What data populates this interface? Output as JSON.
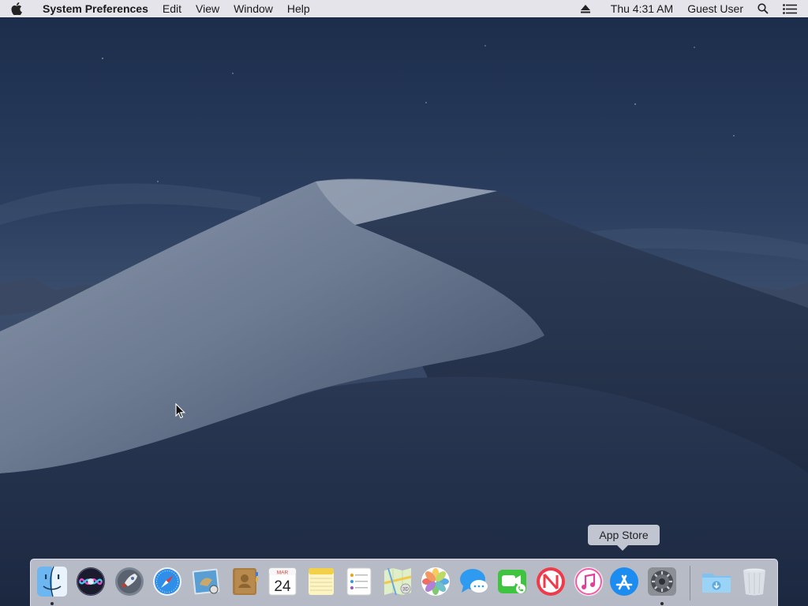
{
  "menubar": {
    "apple_icon": "apple-logo-icon",
    "app_name": "System Preferences",
    "menus": [
      "Edit",
      "View",
      "Window",
      "Help"
    ],
    "eject_icon": "eject-icon",
    "clock": "Thu 4:31 AM",
    "user": "Guest User",
    "search_icon": "spotlight-search-icon",
    "notification_icon": "notification-center-icon"
  },
  "tooltip": {
    "label": "App Store"
  },
  "dock": {
    "apps": [
      {
        "name": "Finder",
        "icon": "finder-icon",
        "running": true
      },
      {
        "name": "Siri",
        "icon": "siri-icon",
        "running": false
      },
      {
        "name": "Launchpad",
        "icon": "launchpad-icon",
        "running": false
      },
      {
        "name": "Safari",
        "icon": "safari-icon",
        "running": false
      },
      {
        "name": "Mail",
        "icon": "mail-icon",
        "running": false
      },
      {
        "name": "Contacts",
        "icon": "contacts-icon",
        "running": false
      },
      {
        "name": "Calendar",
        "icon": "calendar-icon",
        "running": false,
        "month": "MAR",
        "day": "24"
      },
      {
        "name": "Notes",
        "icon": "notes-icon",
        "running": false
      },
      {
        "name": "Reminders",
        "icon": "reminders-icon",
        "running": false
      },
      {
        "name": "Maps",
        "icon": "maps-icon",
        "running": false
      },
      {
        "name": "Photos",
        "icon": "photos-icon",
        "running": false
      },
      {
        "name": "Messages",
        "icon": "messages-icon",
        "running": false
      },
      {
        "name": "FaceTime",
        "icon": "facetime-icon",
        "running": false
      },
      {
        "name": "News",
        "icon": "news-icon",
        "running": false
      },
      {
        "name": "iTunes",
        "icon": "itunes-icon",
        "running": false
      },
      {
        "name": "App Store",
        "icon": "app-store-icon",
        "running": false
      },
      {
        "name": "System Preferences",
        "icon": "system-preferences-icon",
        "running": true
      }
    ],
    "others": [
      {
        "name": "Downloads",
        "icon": "downloads-folder-icon"
      },
      {
        "name": "Trash",
        "icon": "trash-icon"
      }
    ]
  }
}
